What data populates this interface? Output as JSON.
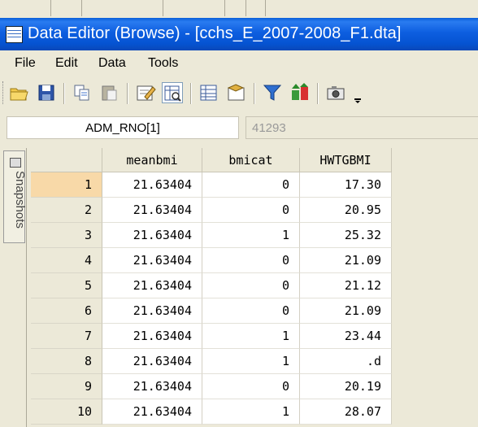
{
  "window": {
    "title": "Data Editor (Browse) - [cchs_E_2007-2008_F1.dta]"
  },
  "menu": [
    "File",
    "Edit",
    "Data",
    "Tools"
  ],
  "toolbar": {
    "buttons": [
      "open-icon",
      "save-icon",
      "copy-icon",
      "paste-icon",
      "edit-mode-icon",
      "browse-mode-icon",
      "variables-manager-icon",
      "properties-icon",
      "filter-icon",
      "sort-icon",
      "snapshot-camera-icon",
      "toolbar-more-icon"
    ]
  },
  "cell_ref": {
    "name": "ADM_RNO[1]",
    "value": "41293"
  },
  "sidebar": {
    "tab_label": "Snapshots"
  },
  "grid": {
    "columns": [
      "meanbmi",
      "bmicat",
      "HWTGBMI"
    ],
    "rows": [
      {
        "n": "1",
        "meanbmi": "21.63404",
        "bmicat": "0",
        "hwtgbmi": "17.30"
      },
      {
        "n": "2",
        "meanbmi": "21.63404",
        "bmicat": "0",
        "hwtgbmi": "20.95"
      },
      {
        "n": "3",
        "meanbmi": "21.63404",
        "bmicat": "1",
        "hwtgbmi": "25.32"
      },
      {
        "n": "4",
        "meanbmi": "21.63404",
        "bmicat": "0",
        "hwtgbmi": "21.09"
      },
      {
        "n": "5",
        "meanbmi": "21.63404",
        "bmicat": "0",
        "hwtgbmi": "21.12"
      },
      {
        "n": "6",
        "meanbmi": "21.63404",
        "bmicat": "0",
        "hwtgbmi": "21.09"
      },
      {
        "n": "7",
        "meanbmi": "21.63404",
        "bmicat": "1",
        "hwtgbmi": "23.44"
      },
      {
        "n": "8",
        "meanbmi": "21.63404",
        "bmicat": "1",
        "hwtgbmi": ".d"
      },
      {
        "n": "9",
        "meanbmi": "21.63404",
        "bmicat": "0",
        "hwtgbmi": "20.19"
      },
      {
        "n": "10",
        "meanbmi": "21.63404",
        "bmicat": "1",
        "hwtgbmi": "28.07"
      }
    ]
  }
}
